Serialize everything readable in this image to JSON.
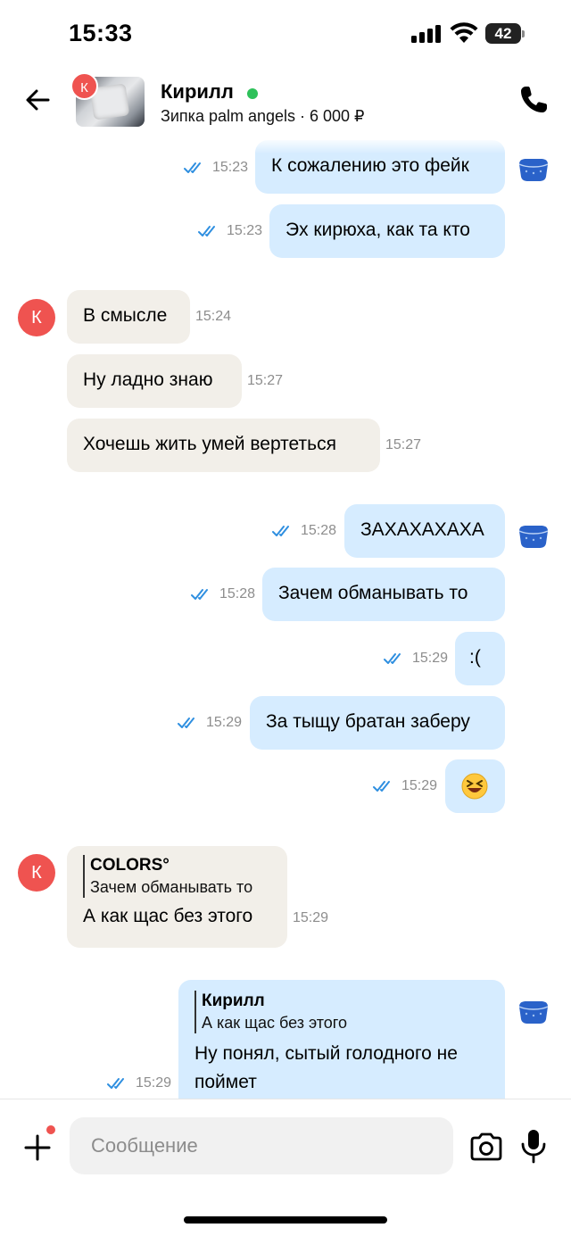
{
  "status_bar": {
    "time": "15:33",
    "battery": "42"
  },
  "header": {
    "avatar_letter": "К",
    "contact_name": "Кирилл",
    "listing": "Зипка palm angels · 6 000 ₽"
  },
  "messages": [
    {
      "text": "К сожалению это фейк",
      "time": "15:23"
    },
    {
      "text": "Эх кирюха, как та кто",
      "time": "15:23"
    },
    {
      "text": "В смысле",
      "time": "15:24"
    },
    {
      "text": "Ну ладно знаю",
      "time": "15:27"
    },
    {
      "text": "Хочешь жить умей вертеться",
      "time": "15:27"
    },
    {
      "text": "ЗАХАХАХАХА",
      "time": "15:28"
    },
    {
      "text": "Зачем обманывать то",
      "time": "15:28"
    },
    {
      "text": ":(",
      "time": "15:29"
    },
    {
      "text": "За тыщу братан заберу",
      "time": "15:29"
    },
    {
      "text": "😆",
      "time": "15:29"
    },
    {
      "text": "А как щас без этого",
      "time": "15:29",
      "quote_author": "COLORS°",
      "quote_text": "Зачем обманывать то"
    },
    {
      "text_line1": "Ну понял, сытый голодного не",
      "text_line2": "поймет",
      "time": "15:29",
      "quote_author": "Кирилл",
      "quote_text": "А как щас без этого"
    }
  ],
  "composer": {
    "placeholder": "Сообщение"
  },
  "colors": {
    "outgoing": "#d6ecff",
    "incoming": "#f2efe9",
    "avatar": "#ef5350",
    "online": "#2ec15a",
    "ticks": "#2f8fe0"
  }
}
